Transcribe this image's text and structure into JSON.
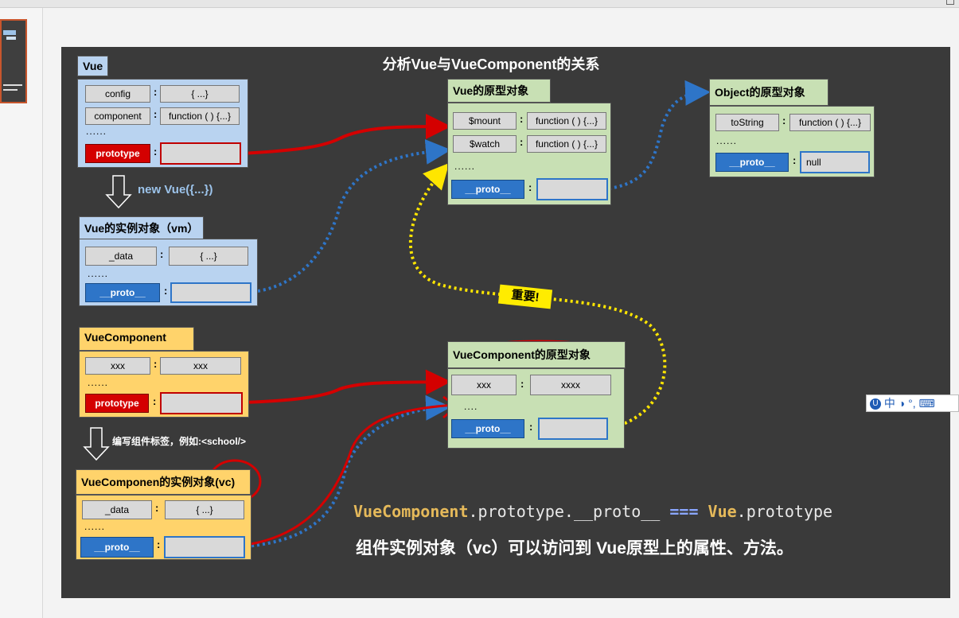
{
  "title": "分析Vue与VueComponent的关系",
  "vue": {
    "header": "Vue",
    "rows": [
      {
        "key": "config",
        "value": "{ ...}"
      },
      {
        "key": "component",
        "value": "function ( ) {...}"
      }
    ],
    "ellipsis": "......",
    "prototype_label": "prototype"
  },
  "new_vue_label": "new Vue({...})",
  "vm": {
    "header": "Vue的实例对象（vm）",
    "rows": [
      {
        "key": "_data",
        "value": "{ ...}"
      }
    ],
    "ellipsis": "......",
    "proto_label": "__proto__"
  },
  "vue_component": {
    "header": "VueComponent",
    "rows": [
      {
        "key": "xxx",
        "value": "xxx"
      }
    ],
    "ellipsis": "......",
    "prototype_label": "prototype"
  },
  "write_tag_label": "编写组件标签，例如:<school/>",
  "vc": {
    "header": "VueComponen的实例对象(vc)",
    "rows": [
      {
        "key": "_data",
        "value": "{ ...}"
      }
    ],
    "ellipsis": "......",
    "proto_label": "__proto__"
  },
  "vue_proto": {
    "header": "Vue的原型对象",
    "rows": [
      {
        "key": "$mount",
        "value": "function ( ) {...}"
      },
      {
        "key": "$watch",
        "value": "function ( ) {...}"
      }
    ],
    "ellipsis": "......",
    "proto_label": "__proto__"
  },
  "object_proto": {
    "header": "Object的原型对象",
    "rows": [
      {
        "key": "toString",
        "value": "function ( ) {...}"
      }
    ],
    "ellipsis": "......",
    "proto_label": "__proto__",
    "proto_value": "null"
  },
  "vc_proto": {
    "header": "VueComponent的原型对象",
    "rows": [
      {
        "key": "xxx",
        "value": "xxxx"
      }
    ],
    "ellipsis": "....",
    "proto_label": "__proto__"
  },
  "important_label": "重要!",
  "code_line": {
    "part1": "VueComponent",
    "part2": ".prototype.__proto__ ",
    "part3": "===",
    "part4": " Vue",
    "part5": ".prototype"
  },
  "summary": "组件实例对象（vc）可以访问到 Vue原型上的属性、方法。",
  "ime_bar_text": "中 ◑ °, ⌨",
  "colors": {
    "slide_bg": "#3a3a3a",
    "blue_panel": "#b9d3f0",
    "yellow_panel": "#ffd36b",
    "green_panel": "#c8e0b4",
    "red_arrow": "#d40000",
    "blue_arrow": "#2e75c8",
    "yellow_arrow": "#ffe600"
  }
}
